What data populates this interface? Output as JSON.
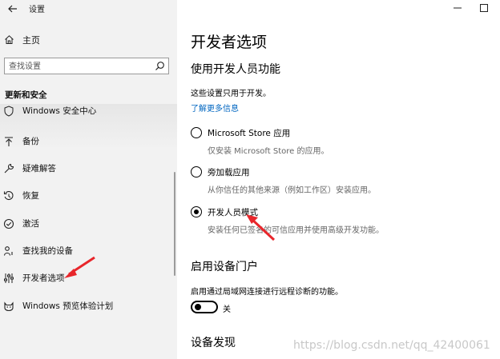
{
  "window": {
    "title": "设置",
    "minimize_icon": "minimize-icon",
    "maximize_icon": "maximize-icon"
  },
  "sidebar": {
    "home_label": "主页",
    "search_placeholder": "查找设置",
    "section_heading": "更新和安全",
    "items": [
      {
        "label": "Windows 安全中心",
        "icon": "shield-icon"
      },
      {
        "label": "备份",
        "icon": "backup-arrow-icon"
      },
      {
        "label": "疑难解答",
        "icon": "wrench-icon"
      },
      {
        "label": "恢复",
        "icon": "recovery-icon"
      },
      {
        "label": "激活",
        "icon": "check-circle-icon"
      },
      {
        "label": "查找我的设备",
        "icon": "location-person-icon"
      },
      {
        "label": "开发者选项",
        "icon": "developer-sliders-icon"
      },
      {
        "label": "Windows 预览体验计划",
        "icon": "insider-cat-icon"
      }
    ]
  },
  "main": {
    "page_title": "开发者选项",
    "dev_features": {
      "heading": "使用开发人员功能",
      "description": "这些设置只用于开发。",
      "learn_more": "了解更多信息",
      "options": [
        {
          "label": "Microsoft Store 应用",
          "description": "仅安装 Microsoft Store 的应用。",
          "selected": false
        },
        {
          "label": "旁加载应用",
          "description": "从你信任的其他来源（例如工作区）安装应用。",
          "selected": false
        },
        {
          "label": "开发人员模式",
          "description": "安装任何已签名的可信应用并使用高级开发功能。",
          "selected": true
        }
      ]
    },
    "device_portal": {
      "heading": "启用设备门户",
      "description": "启用通过局域网连接进行远程诊断的功能。",
      "toggle_state": "关",
      "toggle_on": false
    },
    "device_discovery": {
      "heading": "设备发现"
    }
  },
  "watermark": "https://blog.csdn.net/qq_42400061",
  "colors": {
    "sidebar_bg": "#f2f2f2",
    "link": "#0066c0",
    "annotation_arrow": "#e8262b"
  }
}
